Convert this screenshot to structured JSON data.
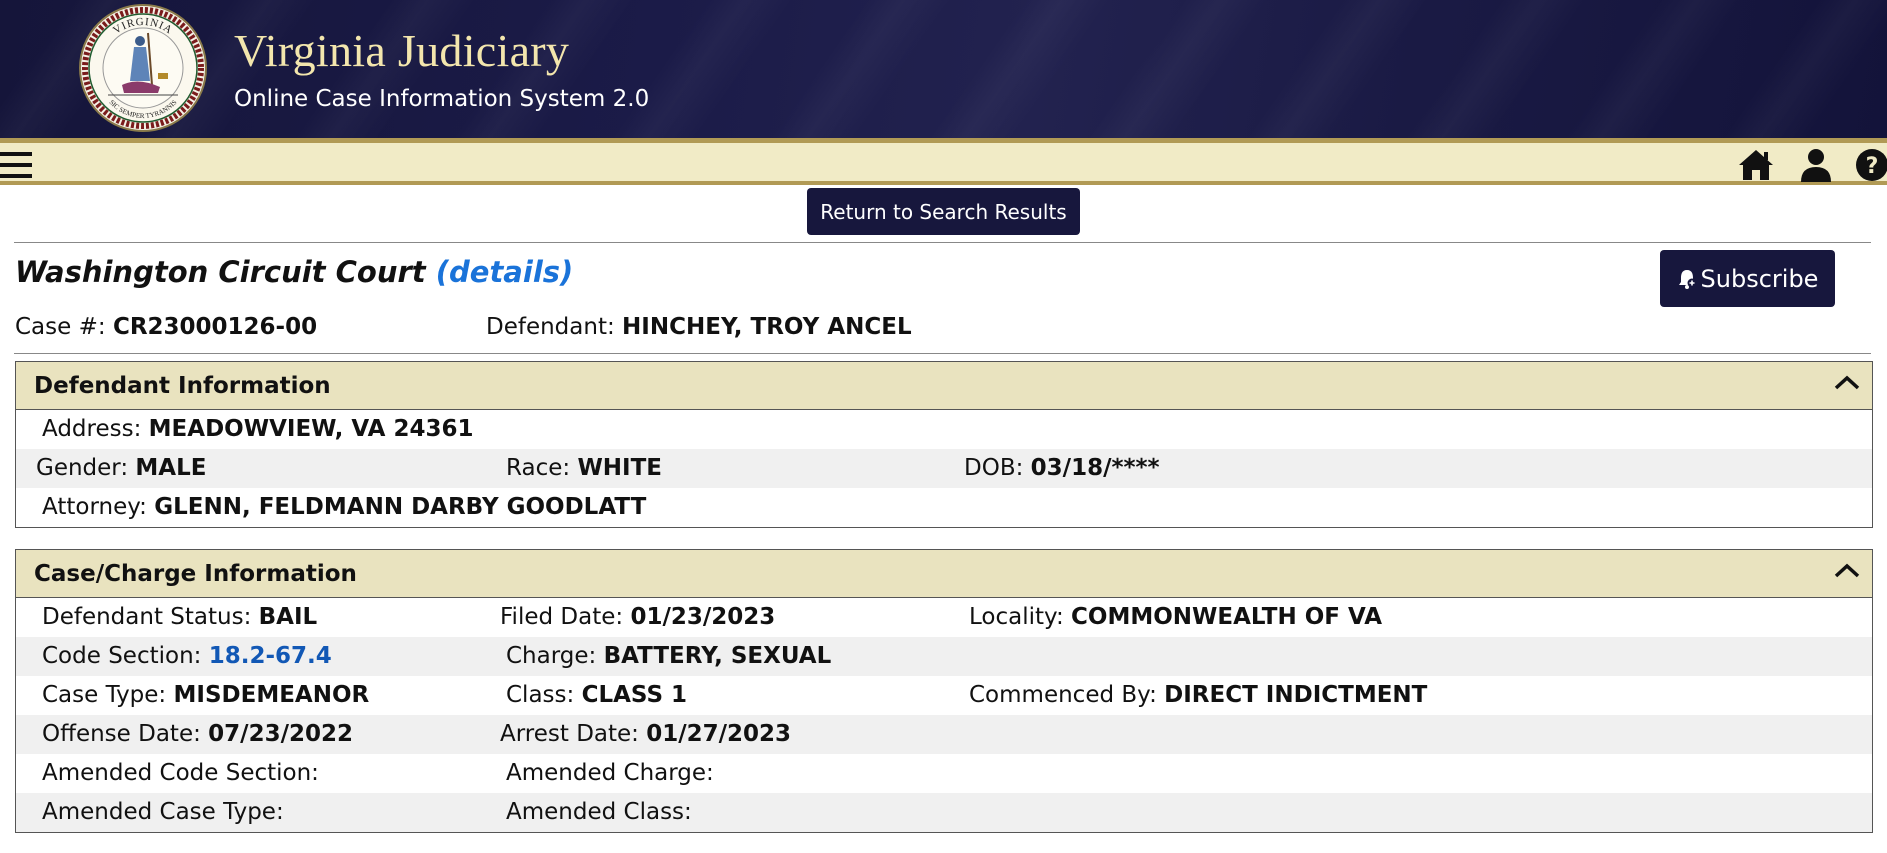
{
  "header": {
    "title": "Virginia Judiciary",
    "subtitle": "Online Case Information System 2.0",
    "seal_top_text": "VIRGINIA",
    "seal_bottom_text": "SIC SEMPER TYRANNIS"
  },
  "nav": {
    "menu_icon": "hamburger-menu-icon",
    "icons": [
      "home-icon",
      "user-icon",
      "help-icon"
    ]
  },
  "actions": {
    "return_label": "Return to Search Results",
    "subscribe_label": "Subscribe"
  },
  "court": {
    "name": "Washington Circuit Court",
    "details_link": "(details)"
  },
  "case": {
    "case_label": "Case #:",
    "case_number": "CR23000126-00",
    "defendant_label": "Defendant:",
    "defendant_name": "HINCHEY, TROY ANCEL"
  },
  "defendant_info": {
    "title": "Defendant Information",
    "address_label": "Address:",
    "address": "MEADOWVIEW, VA 24361",
    "gender_label": "Gender:",
    "gender": "MALE",
    "race_label": "Race:",
    "race": "WHITE",
    "dob_label": "DOB:",
    "dob": "03/18/****",
    "attorney_label": "Attorney:",
    "attorney": "GLENN, FELDMANN DARBY GOODLATT"
  },
  "charge_info": {
    "title": "Case/Charge Information",
    "defendant_status_label": "Defendant Status:",
    "defendant_status": "BAIL",
    "filed_date_label": "Filed Date:",
    "filed_date": "01/23/2023",
    "locality_label": "Locality:",
    "locality": "COMMONWEALTH OF VA",
    "code_section_label": "Code Section:",
    "code_section": "18.2-67.4",
    "charge_label": "Charge:",
    "charge": "BATTERY, SEXUAL",
    "case_type_label": "Case Type:",
    "case_type": "MISDEMEANOR",
    "class_label": "Class:",
    "class": "CLASS 1",
    "commenced_by_label": "Commenced By:",
    "commenced_by": "DIRECT INDICTMENT",
    "offense_date_label": "Offense Date:",
    "offense_date": "07/23/2022",
    "arrest_date_label": "Arrest Date:",
    "arrest_date": "01/27/2023",
    "amended_code_section_label": "Amended Code Section:",
    "amended_charge_label": "Amended Charge:",
    "amended_case_type_label": "Amended Case Type:",
    "amended_class_label": "Amended Class:"
  },
  "colors": {
    "banner": "#1b1b48",
    "title_gold": "#f3e6ad",
    "navbar": "#f1ebc6",
    "panel_header": "#e9e3bf",
    "button": "#17173d",
    "link": "#1a73d9"
  }
}
